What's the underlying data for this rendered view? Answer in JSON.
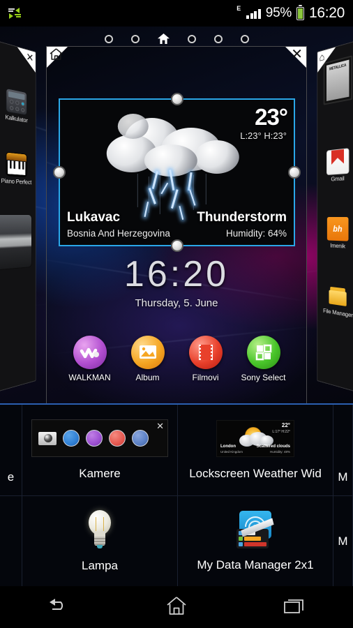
{
  "status_bar": {
    "data_icon": "data-transfer-icon",
    "network_type": "E",
    "signal_icon": "signal-bars-icon",
    "battery_percent": "95%",
    "battery_icon": "battery-icon",
    "time": "16:20"
  },
  "home": {
    "page_indicator": {
      "total": 6,
      "current_index": 2,
      "home_icon": "home-icon"
    },
    "panel": {
      "corner_home_icon": "home-icon",
      "corner_close_icon": "close-icon"
    },
    "weather_widget": {
      "temperature": "23°",
      "high_low": "L:23°  H:23°",
      "city": "Lukavac",
      "country": "Bosnia And Herzegovina",
      "condition": "Thunderstorm",
      "humidity": "Humidity: 64%",
      "condition_icon": "thunderstorm-icon",
      "selection_color": "#2aa7e8",
      "resize_handles": [
        "top",
        "right",
        "bottom",
        "left"
      ]
    },
    "clock_widget": {
      "time": "16:20",
      "date": "Thursday, 5. June"
    },
    "dock": [
      {
        "label": "WALKMAN",
        "icon": "walkman-icon",
        "color": "#b24fd0"
      },
      {
        "label": "Album",
        "icon": "album-icon",
        "color": "#f5a623"
      },
      {
        "label": "Filmovi",
        "icon": "film-icon",
        "color": "#e8402b"
      },
      {
        "label": "Sony Select",
        "icon": "sony-select-icon",
        "color": "#49c52a"
      }
    ],
    "left_peek": {
      "corner_close_icon": "close-icon",
      "items": [
        {
          "label": "Kalkulator",
          "icon": "calculator-icon"
        },
        {
          "label": "Piano Perfect",
          "icon": "piano-icon"
        }
      ],
      "widget": "music-player-widget"
    },
    "right_peek": {
      "corner_home_icon": "home-icon",
      "items": [
        {
          "label": "",
          "icon": "album-art-widget"
        },
        {
          "label": "Gmail",
          "icon": "gmail-icon"
        },
        {
          "label": "Imenik",
          "icon": "contacts-icon",
          "glyph": "bh"
        },
        {
          "label": "File Manager",
          "icon": "file-manager-icon"
        }
      ]
    }
  },
  "widget_picker": {
    "items": [
      {
        "label": "Kamere",
        "preview": "camera-widget-preview",
        "close_icon": "close-icon",
        "circle_colors": [
          "#2f7fd4",
          "#9b4fd0",
          "#e4574f",
          "#5a7fc4"
        ]
      },
      {
        "label": "Lockscreen Weather Wid",
        "preview": "lockscreen-weather-preview",
        "preview_data": {
          "temperature": "22°",
          "high_low": "L:17°  H:22°",
          "city": "London",
          "country": "United Kingdom",
          "condition": "Scattered clouds",
          "humidity": "Humidity: 48%"
        }
      },
      {
        "label": "Lampa",
        "preview": "lightbulb-icon"
      },
      {
        "label": "My Data Manager 2x1",
        "preview": "data-manager-icon"
      }
    ],
    "edge_left_partial": "e",
    "edge_right_partial_row1": "M",
    "edge_right_partial_row2": "M"
  },
  "nav_bar": {
    "back": "back-icon",
    "home": "home-icon",
    "recents": "recent-apps-icon"
  }
}
